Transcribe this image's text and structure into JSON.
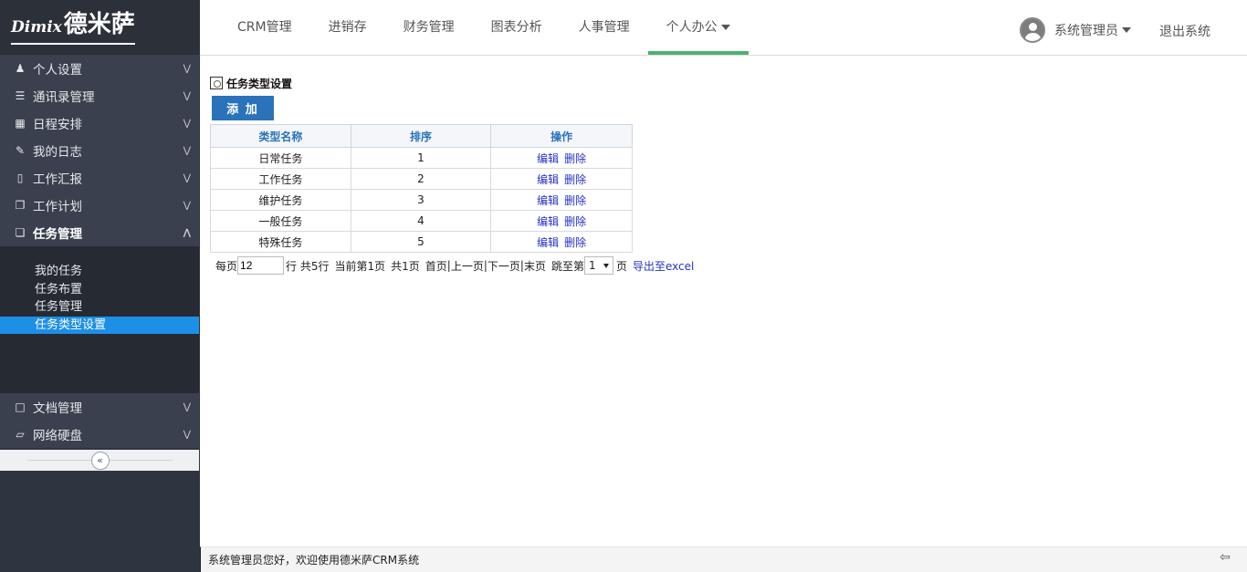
{
  "app": {
    "logo_en": "Dimix",
    "logo_cn": "德米萨"
  },
  "nav": {
    "items": [
      {
        "label": "CRM管理"
      },
      {
        "label": "进销存"
      },
      {
        "label": "财务管理"
      },
      {
        "label": "图表分析"
      },
      {
        "label": "人事管理"
      },
      {
        "label": "个人办公"
      }
    ],
    "active": "个人办公",
    "user_label": "系统管理员",
    "logout_label": "退出系统"
  },
  "sidebar": {
    "items": [
      {
        "label": "个人设置",
        "icon": "user-icon"
      },
      {
        "label": "通讯录管理",
        "icon": "list-icon"
      },
      {
        "label": "日程安排",
        "icon": "calendar-icon"
      },
      {
        "label": "我的日志",
        "icon": "pencil-icon"
      },
      {
        "label": "工作汇报",
        "icon": "file-icon"
      },
      {
        "label": "工作计划",
        "icon": "copy-icon"
      },
      {
        "label": "任务管理",
        "icon": "files-icon"
      }
    ],
    "sub_items": [
      {
        "label": "我的任务"
      },
      {
        "label": "任务布置"
      },
      {
        "label": "任务管理"
      },
      {
        "label": "任务类型设置"
      }
    ],
    "bottom_items": [
      {
        "label": "文档管理",
        "icon": "folder-icon"
      },
      {
        "label": "网络硬盘",
        "icon": "folder-open-icon"
      }
    ]
  },
  "page": {
    "title": "任务类型设置",
    "add_label": "添 加"
  },
  "table": {
    "headers": [
      "类型名称",
      "排序",
      "操作"
    ],
    "rows": [
      {
        "name": "日常任务",
        "order": "1",
        "edit": "编辑",
        "delete": "删除"
      },
      {
        "name": "工作任务",
        "order": "2",
        "edit": "编辑",
        "delete": "删除"
      },
      {
        "name": "维护任务",
        "order": "3",
        "edit": "编辑",
        "delete": "删除"
      },
      {
        "name": "一般任务",
        "order": "4",
        "edit": "编辑",
        "delete": "删除"
      },
      {
        "name": "特殊任务",
        "order": "5",
        "edit": "编辑",
        "delete": "删除"
      }
    ]
  },
  "pager": {
    "per_page_label": "每页",
    "per_page_value": "12",
    "rows_label": "行 共5行",
    "current_label": "当前第1页",
    "total_pages_label": "共1页",
    "first": "首页",
    "prev": "上一页",
    "next": "下一页",
    "last": "末页",
    "sep": "|",
    "jump_label": "跳至第",
    "jump_value": "1",
    "page_suffix": "页",
    "export_label": "导出至excel"
  },
  "footer": {
    "welcome": "系统管理员您好，欢迎使用德米萨CRM系统"
  },
  "colors": {
    "sidebar_bg": "#2f3441",
    "accent": "#1e8fe6",
    "nav_active": "#4cb26e",
    "button": "#2a73ba"
  }
}
